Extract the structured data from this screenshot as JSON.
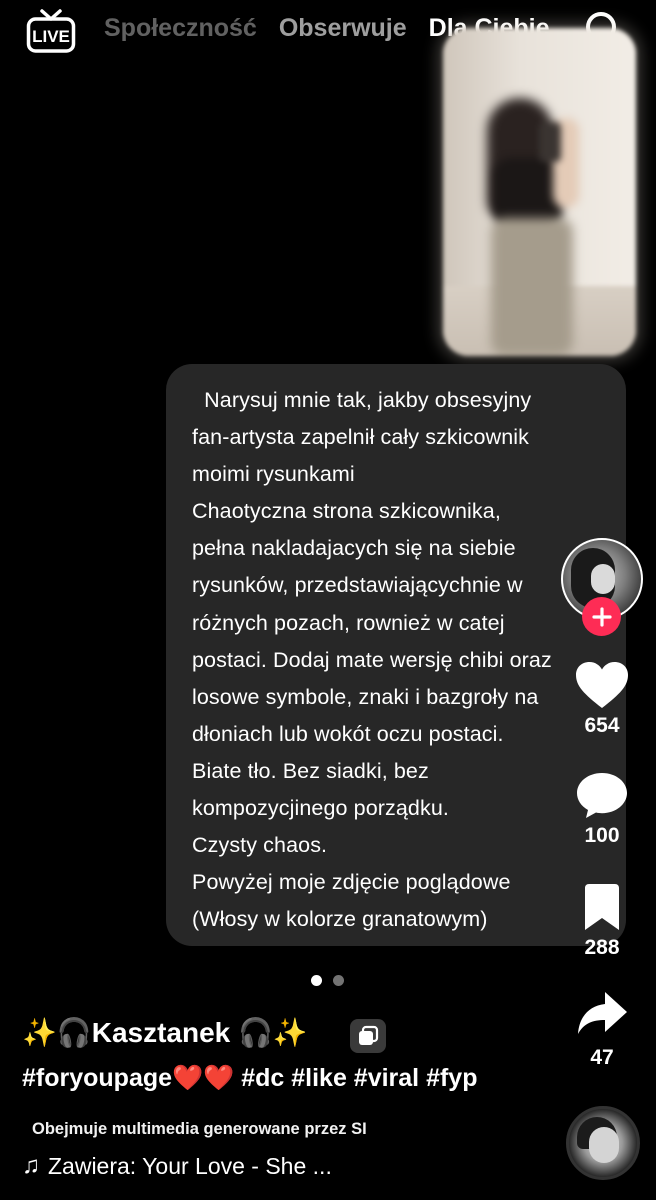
{
  "topbar": {
    "live_label": "LIVE",
    "tabs": [
      "Społeczność",
      "Obserwuje",
      "Dla Ciebie"
    ],
    "active_tab": "Dla Ciebie",
    "search_icon": "search-icon"
  },
  "post": {
    "prompt_lines": [
      "  Narysuj mnie tak, jakby obsesyjny",
      "fan-artysta zapelnił cały szkicownik",
      "moimi rysunkami",
      "Chaotyczna strona szkicownika,",
      "pełna nakladajacych się na siebie",
      "rysunków, przedstawiającychnie w",
      "różnych pozach, rownież w catej",
      "postaci. Dodaj mate wersję chibi oraz",
      "losowe symbole, znaki i bazgroły na",
      "dłoniach lub wokót oczu postaci.",
      "Biate tło. Bez siadki, bez",
      "kompozycjinego porządku.",
      "Czysty chaos.",
      "Powyżej moje zdjęcie poglądowe",
      "(Włosy w kolorze granatowym)"
    ],
    "carousel": {
      "total": 2,
      "current": 1
    },
    "username": "✨🎧Kasztanek 🎧✨",
    "hashtags": "#foryoupage❤️❤️ #dc #like #viral #fyp",
    "ai_label": "Obejmuje multimedia generowane przez SI",
    "music": "Zawiera: Your Love - She ..."
  },
  "actions": {
    "likes": "654",
    "comments": "100",
    "saves": "288",
    "shares": "47"
  },
  "colors": {
    "background": "#000000",
    "card": "#272727",
    "follow": "#fe2c55"
  }
}
